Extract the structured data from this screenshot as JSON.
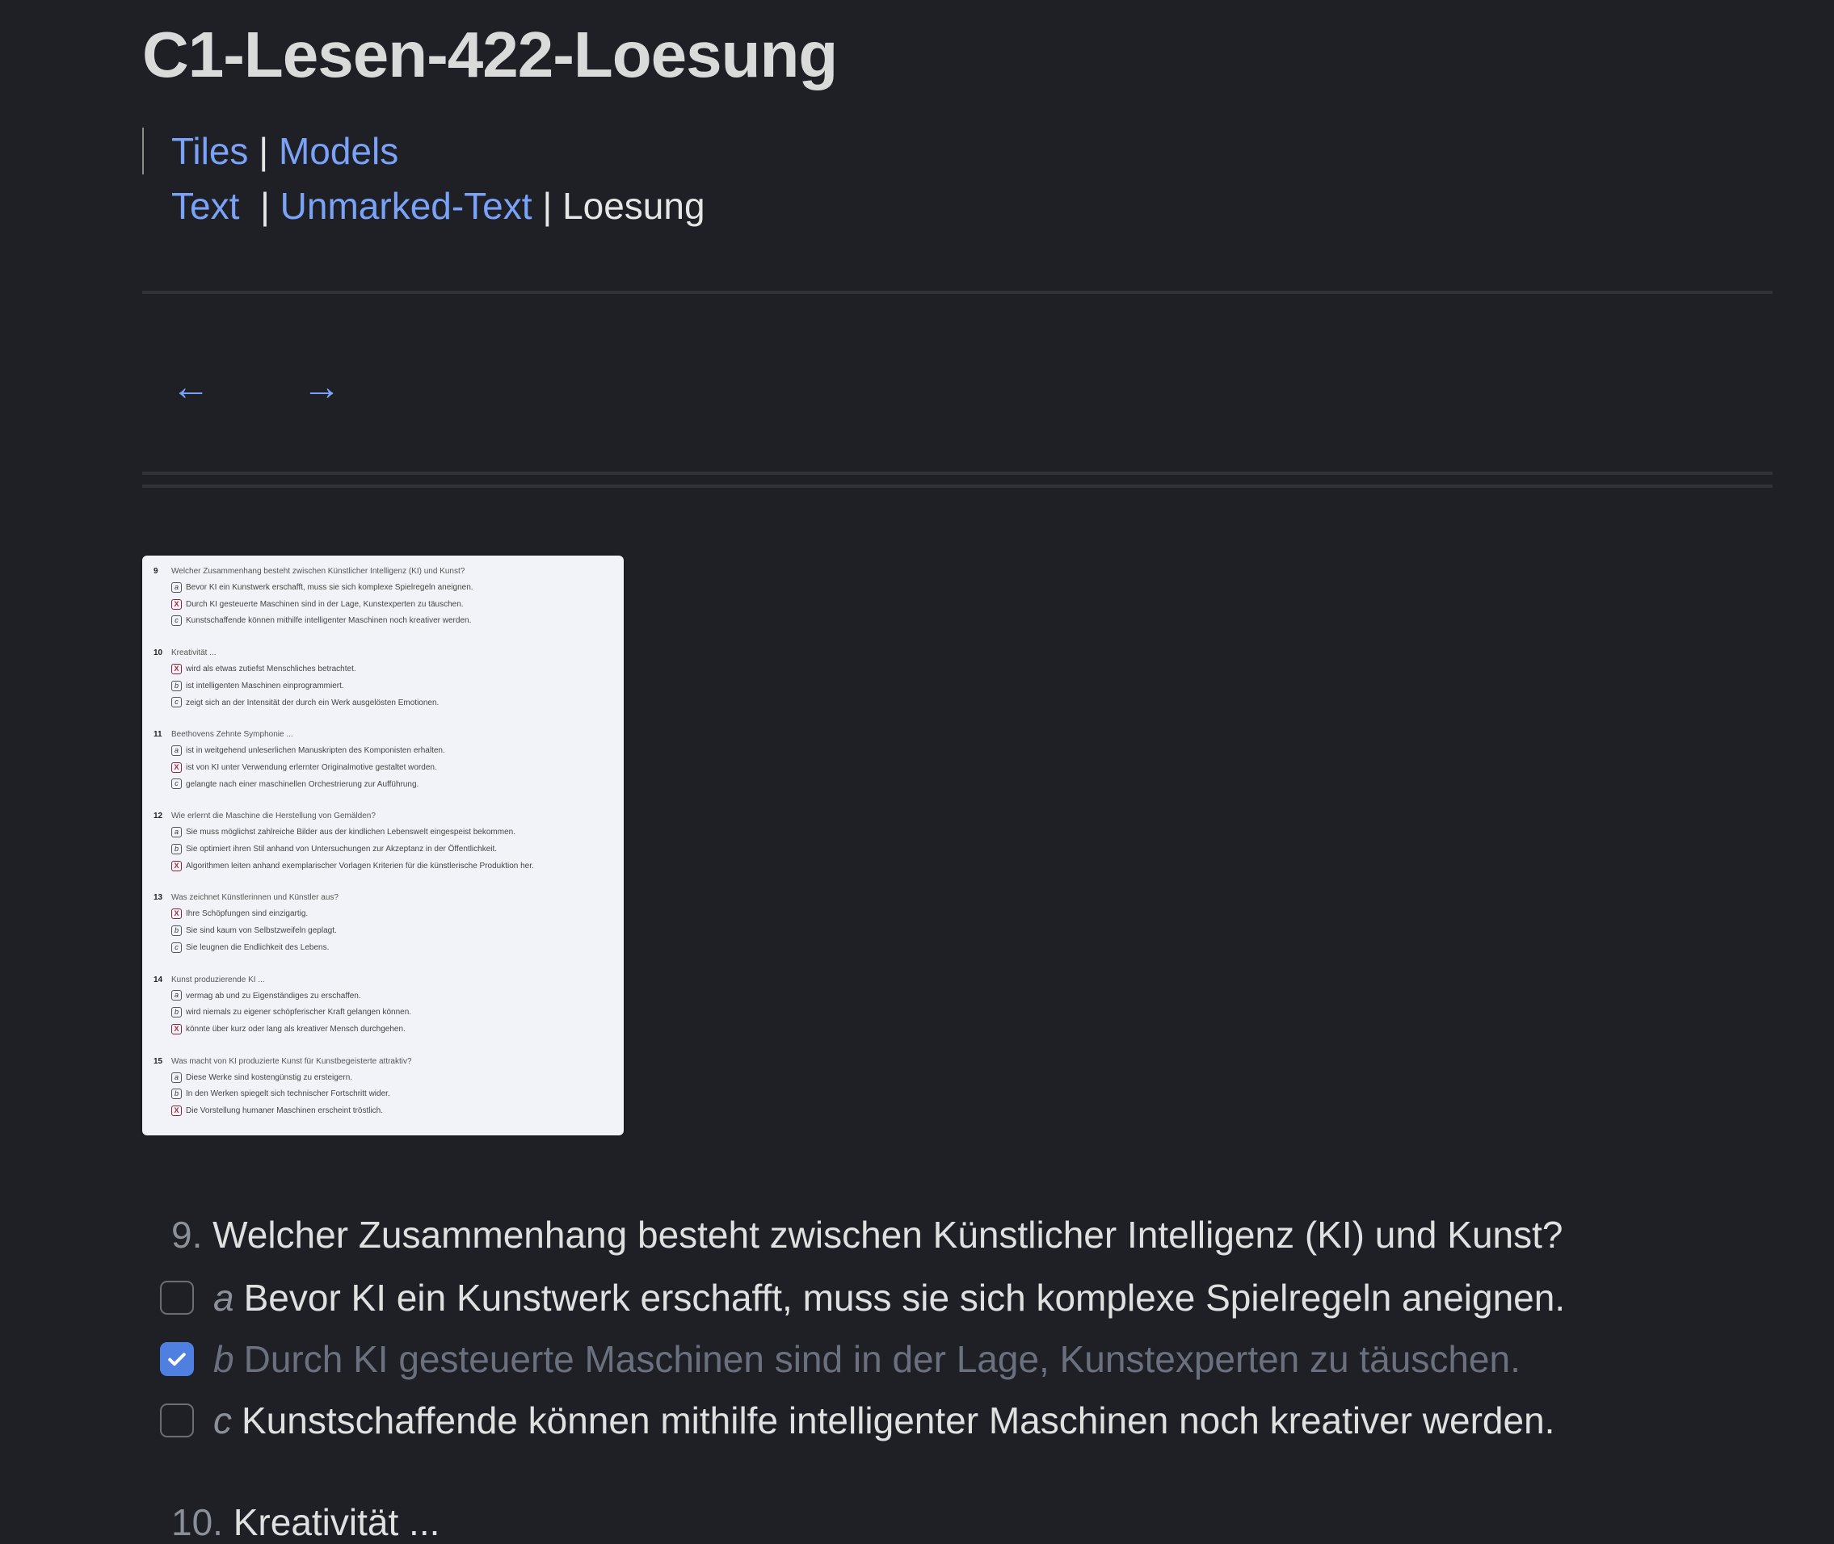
{
  "page": {
    "title": "C1-Lesen-422-Loesung"
  },
  "nav": {
    "tiles": "Tiles",
    "sep": "|",
    "models": "Models",
    "text": "Text",
    "unmarked": "Unmarked-Text",
    "current": "Loesung"
  },
  "arrows": {
    "prev": "←",
    "next": "→"
  },
  "scan": {
    "questions": [
      {
        "num": "9",
        "title": "Welcher Zusammenhang besteht zwischen Künstlicher Intelligenz (KI) und Kunst?",
        "options": [
          {
            "mark": "a",
            "text": "Bevor KI ein Kunstwerk erschafft, muss sie sich komplexe Spielregeln aneignen."
          },
          {
            "mark": "X",
            "text": "Durch KI gesteuerte Maschinen sind in der Lage, Kunstexperten zu täuschen."
          },
          {
            "mark": "c",
            "text": "Kunstschaffende können mithilfe intelligenter Maschinen noch kreativer werden."
          }
        ]
      },
      {
        "num": "10",
        "title": "Kreativität ...",
        "options": [
          {
            "mark": "X",
            "text": "wird als etwas zutiefst Menschliches betrachtet."
          },
          {
            "mark": "b",
            "text": "ist intelligenten Maschinen einprogrammiert."
          },
          {
            "mark": "c",
            "text": "zeigt sich an der Intensität der durch ein Werk ausgelösten Emotionen."
          }
        ]
      },
      {
        "num": "11",
        "title": "Beethovens Zehnte Symphonie ...",
        "options": [
          {
            "mark": "a",
            "text": "ist in weitgehend unleserlichen Manuskripten des Komponisten erhalten."
          },
          {
            "mark": "X",
            "text": "ist von KI unter Verwendung erlernter Originalmotive gestaltet worden."
          },
          {
            "mark": "c",
            "text": "gelangte nach einer maschinellen Orchestrierung zur Aufführung."
          }
        ]
      },
      {
        "num": "12",
        "title": "Wie erlernt die Maschine die Herstellung von Gemälden?",
        "options": [
          {
            "mark": "a",
            "text": "Sie muss möglichst zahlreiche Bilder aus der kindlichen Lebenswelt eingespeist bekommen."
          },
          {
            "mark": "b",
            "text": "Sie optimiert ihren Stil anhand von Untersuchungen zur Akzeptanz in der Öffentlichkeit."
          },
          {
            "mark": "X",
            "text": "Algorithmen leiten anhand exemplarischer Vorlagen Kriterien für die künstlerische Produktion her."
          }
        ]
      },
      {
        "num": "13",
        "title": "Was zeichnet Künstlerinnen und Künstler aus?",
        "options": [
          {
            "mark": "X",
            "text": "Ihre Schöpfungen sind einzigartig."
          },
          {
            "mark": "b",
            "text": "Sie sind kaum von Selbstzweifeln geplagt."
          },
          {
            "mark": "c",
            "text": "Sie leugnen die Endlichkeit des Lebens."
          }
        ]
      },
      {
        "num": "14",
        "title": "Kunst produzierende KI ...",
        "options": [
          {
            "mark": "a",
            "text": "vermag ab und zu Eigenständiges zu erschaffen."
          },
          {
            "mark": "b",
            "text": "wird niemals zu eigener schöpferischer Kraft gelangen können."
          },
          {
            "mark": "X",
            "text": "könnte über kurz oder lang als kreativer Mensch durchgehen."
          }
        ]
      },
      {
        "num": "15",
        "title": "Was macht von KI produzierte Kunst für Kunstbegeisterte attraktiv?",
        "options": [
          {
            "mark": "a",
            "text": "Diese Werke sind kostengünstig zu ersteigern."
          },
          {
            "mark": "b",
            "text": "In den Werken spiegelt sich technischer Fortschritt wider."
          },
          {
            "mark": "X",
            "text": "Die Vorstellung humaner Maschinen erscheint tröstlich."
          }
        ]
      }
    ]
  },
  "question9": {
    "num": "9.",
    "title": "Welcher Zusammenhang besteht zwischen Künstlicher Intelligenz (KI) und Kunst?",
    "options": [
      {
        "letter": "a",
        "text": "Bevor KI ein Kunstwerk erschafft, muss sie sich komplexe Spielregeln aneignen.",
        "checked": false
      },
      {
        "letter": "b",
        "text": "Durch KI gesteuerte Maschinen sind in der Lage, Kunstexperten zu täuschen.",
        "checked": true
      },
      {
        "letter": "c",
        "text": "Kunstschaffende können mithilfe intelligenter Maschinen noch kreativer werden.",
        "checked": false
      }
    ]
  },
  "question10": {
    "num": "10.",
    "title": "Kreativität ..."
  },
  "colors": {
    "background": "#1e2026",
    "link": "#7aa2f7",
    "checkbox_checked": "#4f7fe0"
  }
}
